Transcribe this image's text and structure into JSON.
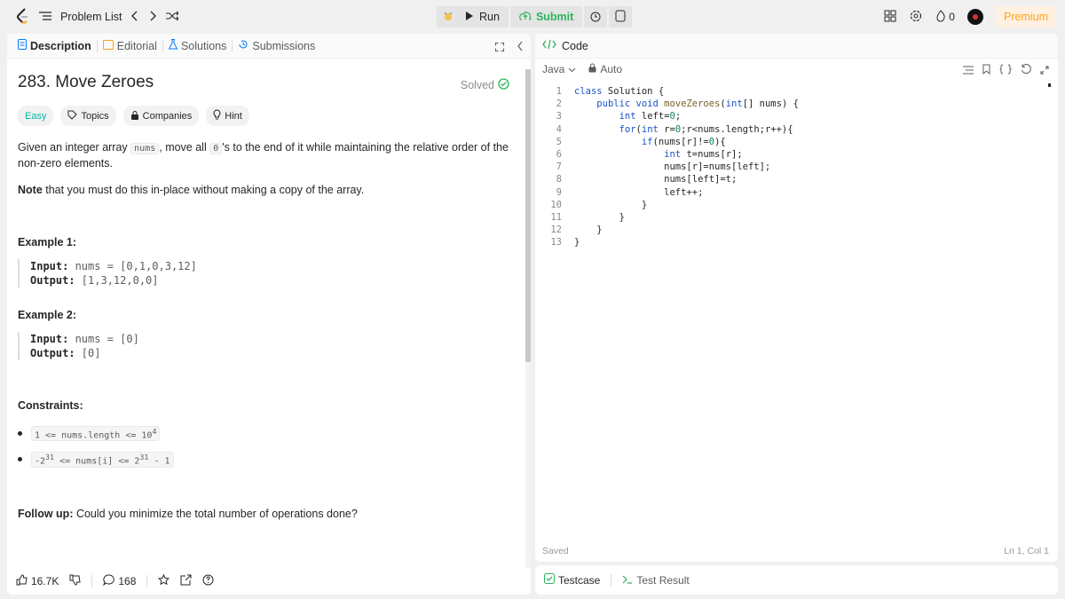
{
  "topbar": {
    "problem_list": "Problem List",
    "run": "Run",
    "submit": "Submit",
    "premium": "Premium",
    "streak": "0"
  },
  "left": {
    "tabs": {
      "description": "Description",
      "editorial": "Editorial",
      "solutions": "Solutions",
      "submissions": "Submissions"
    },
    "title": "283. Move Zeroes",
    "solved": "Solved",
    "chips": {
      "difficulty": "Easy",
      "topics": "Topics",
      "companies": "Companies",
      "hint": "Hint"
    },
    "desc": {
      "p1a": "Given an integer array ",
      "p1code1": "nums",
      "p1b": ", move all ",
      "p1code2": "0",
      "p1c": "'s to the end of it while maintaining the relative order of the non-zero elements.",
      "note_bold": "Note",
      "note_rest": " that you must do this in-place without making a copy of the array."
    },
    "examples": [
      {
        "title": "Example 1:",
        "input_label": "Input:",
        "input": " nums = [0,1,0,3,12]",
        "output_label": "Output:",
        "output": " [1,3,12,0,0]"
      },
      {
        "title": "Example 2:",
        "input_label": "Input:",
        "input": " nums = [0]",
        "output_label": "Output:",
        "output": " [0]"
      }
    ],
    "constraints_title": "Constraints:",
    "constraints": {
      "c1": "1 <= nums.length <= 10",
      "c1_sup": "4",
      "c2a": "-2",
      "c2a_sup": "31",
      "c2b": " <= nums[i] <= 2",
      "c2b_sup": "31",
      "c2c": " - 1"
    },
    "followup_bold": "Follow up:",
    "followup_rest": " Could you minimize the total number of operations done?",
    "footer": {
      "likes": "16.7K",
      "comments": "168"
    }
  },
  "right": {
    "header": "Code",
    "language": "Java",
    "auto": "Auto",
    "lines": [
      "class Solution {",
      "    public void moveZeroes(int[] nums) {",
      "        int left=0;",
      "        for(int r=0;r<nums.length;r++){",
      "            if(nums[r]!=0){",
      "                int t=nums[r];",
      "                nums[r]=nums[left];",
      "                nums[left]=t;",
      "                left++;",
      "            }",
      "        }",
      "    }",
      "}"
    ],
    "saved": "Saved",
    "cursor": "Ln 1, Col 1"
  },
  "bottom": {
    "testcase": "Testcase",
    "test_result": "Test Result"
  }
}
